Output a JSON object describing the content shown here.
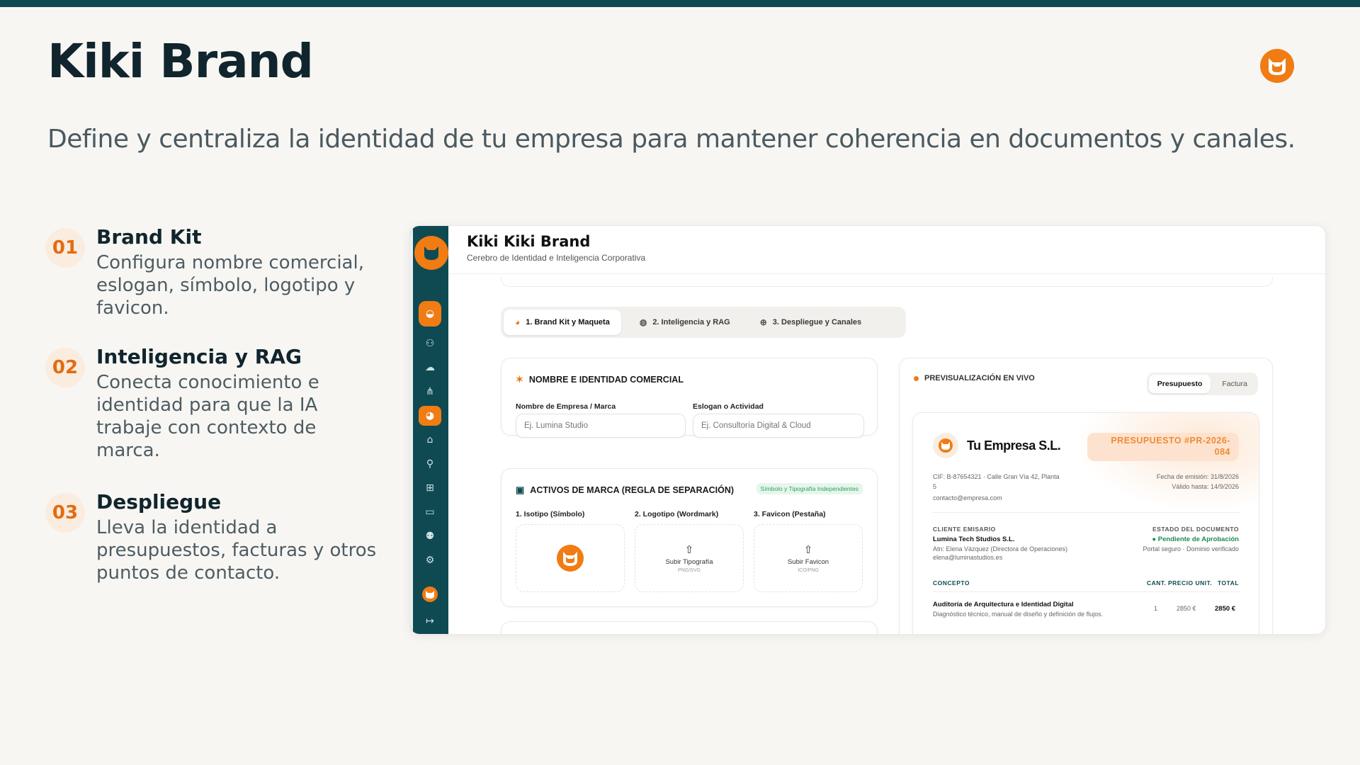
{
  "slide": {
    "title": "Kiki Brand",
    "subtitle": "Define y centraliza la identidad de tu empresa para mantener coherencia en documentos y canales."
  },
  "features": [
    {
      "num": "01",
      "title": "Brand Kit",
      "desc": "Configura nombre comercial, eslogan, símbolo, logotipo y favicon."
    },
    {
      "num": "02",
      "title": "Inteligencia y RAG",
      "desc": "Conecta conocimiento e identidad para que la IA trabaje con contexto de marca."
    },
    {
      "num": "03",
      "title": "Despliegue",
      "desc": "Lleva la identidad a presupuestos, facturas y otros puntos de contacto."
    }
  ],
  "colors": {
    "accent": "#f07c13",
    "primary": "#0f4a52",
    "success": "#2aa15a"
  },
  "app": {
    "title": "Kiki Kiki Brand",
    "subtitle": "Cerebro de Identidad e Inteligencia Corporativa",
    "sidebar_icons": [
      "cat-logo-icon",
      "brand-icon",
      "users-icon",
      "cloud-icon",
      "network-icon",
      "palette-icon",
      "home-icon",
      "user-search-icon",
      "widgets-icon",
      "card-icon",
      "user-settings-icon",
      "settings-icon",
      "profile-icon",
      "logout-icon"
    ],
    "tabs": [
      {
        "label": "1. Brand Kit y Maqueta",
        "icon": "palette-icon"
      },
      {
        "label": "2. Inteligencia y RAG",
        "icon": "brain-icon"
      },
      {
        "label": "3. Despliegue y Canales",
        "icon": "globe-icon"
      }
    ],
    "identity": {
      "title": "NOMBRE E IDENTIDAD COMERCIAL",
      "name_label": "Nombre de Empresa / Marca",
      "name_placeholder": "Ej. Lumina Studio",
      "slogan_label": "Eslogan o Actividad",
      "slogan_placeholder": "Ej. Consultoría Digital & Cloud"
    },
    "assets": {
      "title": "ACTIVOS DE MARCA (REGLA DE SEPARACIÓN)",
      "badge": "Símbolo y Tipografía Independientes",
      "isotipo_label": "1. Isotipo (Símbolo)",
      "logotipo_label": "2. Logotipo (Wordmark)",
      "favicon_label": "3. Favicon (Pestaña)",
      "logotipo_upload": "Subir Tipografía",
      "logotipo_formats": "PNG/SVG",
      "favicon_upload": "Subir Favicon",
      "favicon_formats": "ICO/PNG"
    },
    "preview": {
      "title": "PREVISUALIZACIÓN EN VIVO",
      "toggle": [
        "Presupuesto",
        "Factura"
      ],
      "company": "Tu Empresa S.L.",
      "badge_line1": "PRESUPUESTO #PR-2026-",
      "badge_line2": "084",
      "cif": "CIF: B-87654321 · Calle Gran Vía 42, Planta",
      "cif2": "5",
      "email": "contacto@empresa.com",
      "issue_date": "Fecha de emisión: 31/8/2026",
      "valid_until": "Válido hasta: 14/9/2026",
      "client_caption": "CLIENTE EMISARIO",
      "client_name": "Lumina Tech Studios S.L.",
      "client_attn": "Atn: Elena Vázquez (Directora de Operaciones)",
      "client_email": "elena@luminastudios.es",
      "status_caption": "ESTADO DEL DOCUMENTO",
      "status_value": "Pendiente de Aprobación",
      "status_sub": "Portal seguro · Dominio verificado",
      "col_concept": "CONCEPTO",
      "col_qty": "CANT.",
      "col_price": "PRECIO UNIT.",
      "col_total": "TOTAL",
      "item_title": "Auditoría de Arquitectura e Identidad Digital",
      "item_desc": "Diagnóstico técnico, manual de diseño y definición de flujos.",
      "item_qty": "1",
      "item_price": "2850 €",
      "item_total": "2850 €"
    }
  }
}
